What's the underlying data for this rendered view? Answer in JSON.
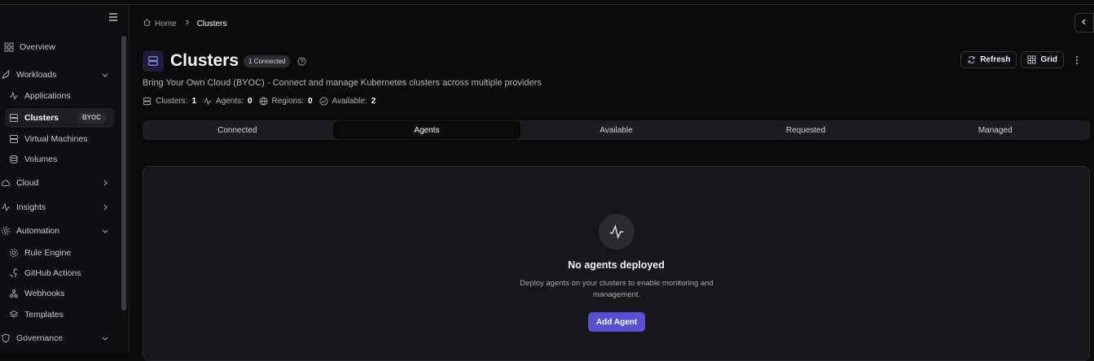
{
  "sidebar": {
    "items": [
      {
        "label": "Overview",
        "icon": "grid-icon"
      },
      {
        "label": "Workloads",
        "icon": "rocket-icon"
      },
      {
        "label": "Applications",
        "icon": "activity-icon"
      },
      {
        "label": "Clusters",
        "icon": "server-icon",
        "badge": "BYOC"
      },
      {
        "label": "Virtual Machines",
        "icon": "server-icon"
      },
      {
        "label": "Volumes",
        "icon": "database-icon"
      },
      {
        "label": "Cloud",
        "icon": "cloud-icon"
      },
      {
        "label": "Insights",
        "icon": "activity-icon"
      },
      {
        "label": "Automation",
        "icon": "gear-icon"
      },
      {
        "label": "Rule Engine",
        "icon": "gear-icon"
      },
      {
        "label": "GitHub Actions",
        "icon": "github-icon"
      },
      {
        "label": "Webhooks",
        "icon": "webhook-icon"
      },
      {
        "label": "Templates",
        "icon": "layers-icon"
      },
      {
        "label": "Governance",
        "icon": "shield-icon"
      }
    ]
  },
  "breadcrumb": {
    "home": "Home",
    "current": "Clusters"
  },
  "page": {
    "title": "Clusters",
    "badge": "1 Connected",
    "subtitle": "Bring Your Own Cloud (BYOC) - Connect and manage Kubernetes clusters across multiple providers"
  },
  "stats": [
    {
      "label": "Clusters:",
      "value": "1"
    },
    {
      "label": "Agents:",
      "value": "0"
    },
    {
      "label": "Regions:",
      "value": "0"
    },
    {
      "label": "Available:",
      "value": "2"
    }
  ],
  "actions": {
    "refresh": "Refresh",
    "grid": "Grid"
  },
  "tabs": [
    "Connected",
    "Agents",
    "Available",
    "Requested",
    "Managed"
  ],
  "active_tab": "Agents",
  "empty": {
    "title": "No agents deployed",
    "description": "Deploy agents on your clusters to enable monitoring and management.",
    "button": "Add Agent"
  },
  "colors": {
    "accent": "#5b4fd6",
    "background": "#0b0b0c",
    "card": "#171719"
  }
}
